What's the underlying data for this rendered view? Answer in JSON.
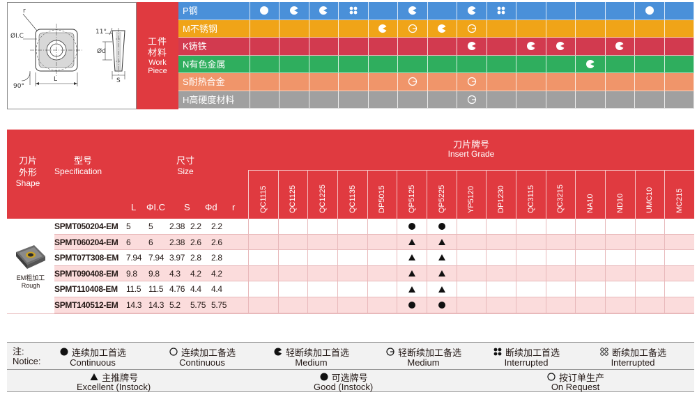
{
  "diagram": {
    "labels": {
      "r": "r",
      "ic": "ØI.C",
      "d": "Ød",
      "angle11": "11°",
      "angle90": "90°",
      "l": "L",
      "s": "S"
    }
  },
  "workpiece": {
    "label_zh_1": "工件",
    "label_zh_2": "材料",
    "label_en_1": "Work",
    "label_en_2": "Piece"
  },
  "materials": [
    {
      "name": "P钢",
      "color": "#4a90d9",
      "cells": [
        "C",
        "M",
        "M",
        "I",
        "",
        "M",
        "",
        "M",
        "I",
        "",
        "",
        "",
        "",
        "C",
        ""
      ]
    },
    {
      "name": "M不锈钢",
      "color": "#f0a418",
      "cells": [
        "",
        "",
        "",
        "",
        "M",
        "m",
        "M",
        "m",
        "",
        "",
        "",
        "",
        "",
        "",
        ""
      ]
    },
    {
      "name": "K铸铁",
      "color": "#d23a4f",
      "cells": [
        "",
        "",
        "",
        "",
        "",
        "",
        "",
        "M",
        "",
        "M",
        "M",
        "",
        "M",
        "",
        ""
      ]
    },
    {
      "name": "N有色金属",
      "color": "#2fae5e",
      "cells": [
        "",
        "",
        "",
        "",
        "",
        "",
        "",
        "",
        "",
        "",
        "",
        "M",
        "",
        "",
        ""
      ]
    },
    {
      "name": "S耐热合金",
      "color": "#f0956a",
      "cells": [
        "",
        "",
        "",
        "",
        "",
        "m",
        "",
        "m",
        "",
        "",
        "",
        "",
        "",
        "",
        ""
      ]
    },
    {
      "name": "H高硬度材料",
      "color": "#a0a0a0",
      "cells": [
        "",
        "",
        "",
        "",
        "",
        "",
        "",
        "m",
        "",
        "",
        "",
        "",
        "",
        "",
        ""
      ]
    }
  ],
  "spec": {
    "shape_zh_1": "刀片",
    "shape_zh_2": "外形",
    "shape_en": "Shape",
    "spec_zh": "型号",
    "spec_en": "Specification",
    "size_zh": "尺寸",
    "size_en": "Size",
    "grade_zh": "刀片牌号",
    "grade_en": "Insert Grade",
    "dims": [
      "L",
      "ΦI.C",
      "S",
      "Φd",
      "r"
    ],
    "grades": [
      "QC1115",
      "QC1125",
      "QC1225",
      "QC1135",
      "DP5015",
      "QP5125",
      "QP5225",
      "YP5120",
      "DP1230",
      "QC3115",
      "QC3215",
      "NA10",
      "ND10",
      "UMC10",
      "MC215"
    ],
    "shape_label_zh": "EM粗加工",
    "shape_label_en": "Rough",
    "rows": [
      {
        "model": "SPMT050204-EM",
        "L": "5",
        "IC": "5",
        "S": "2.38",
        "d": "2.2",
        "r": "2.2",
        "marks": [
          "",
          "",
          "",
          "",
          "",
          "dot",
          "dot",
          "",
          "",
          "",
          "",
          "",
          "",
          "",
          ""
        ]
      },
      {
        "model": "SPMT060204-EM",
        "L": "6",
        "IC": "6",
        "S": "2.38",
        "d": "2.6",
        "r": "2.6",
        "marks": [
          "",
          "",
          "",
          "",
          "",
          "tri",
          "tri",
          "",
          "",
          "",
          "",
          "",
          "",
          "",
          ""
        ]
      },
      {
        "model": "SPMT07T308-EM",
        "L": "7.94",
        "IC": "7.94",
        "S": "3.97",
        "d": "2.8",
        "r": "2.8",
        "marks": [
          "",
          "",
          "",
          "",
          "",
          "tri",
          "tri",
          "",
          "",
          "",
          "",
          "",
          "",
          "",
          ""
        ]
      },
      {
        "model": "SPMT090408-EM",
        "L": "9.8",
        "IC": "9.8",
        "S": "4.3",
        "d": "4.2",
        "r": "4.2",
        "marks": [
          "",
          "",
          "",
          "",
          "",
          "tri",
          "tri",
          "",
          "",
          "",
          "",
          "",
          "",
          "",
          ""
        ]
      },
      {
        "model": "SPMT110408-EM",
        "L": "11.5",
        "IC": "11.5",
        "S": "4.76",
        "d": "4.4",
        "r": "4.4",
        "marks": [
          "",
          "",
          "",
          "",
          "",
          "tri",
          "tri",
          "",
          "",
          "",
          "",
          "",
          "",
          "",
          ""
        ]
      },
      {
        "model": "SPMT140512-EM",
        "L": "14.3",
        "IC": "14.3",
        "S": "5.2",
        "d": "5.75",
        "r": "5.75",
        "marks": [
          "",
          "",
          "",
          "",
          "",
          "dot",
          "dot",
          "",
          "",
          "",
          "",
          "",
          "",
          "",
          ""
        ]
      }
    ]
  },
  "notice": {
    "label_zh": "注:",
    "label_en": "Notice:",
    "legend": [
      {
        "zh": "连续加工首选",
        "en": "Continuous",
        "icon": "filled-circle-icon"
      },
      {
        "zh": "连续加工备选",
        "en": "Continuous",
        "icon": "open-circle-icon"
      },
      {
        "zh": "轻断续加工首选",
        "en": "Medium",
        "icon": "half-filled-circle-icon"
      },
      {
        "zh": "轻断续加工备选",
        "en": "Medium",
        "icon": "half-open-circle-icon"
      },
      {
        "zh": "断续加工首选",
        "en": "Interrupted",
        "icon": "filled-cross-icon"
      },
      {
        "zh": "断续加工备选",
        "en": "Interrupted",
        "icon": "open-cross-icon"
      }
    ],
    "legend2": [
      {
        "zh": "主推牌号",
        "en": "Excellent (Instock)",
        "icon": "triangle-icon"
      },
      {
        "zh": "可选牌号",
        "en": "Good (Instock)",
        "icon": "dot-icon"
      },
      {
        "zh": "按订单生产",
        "en": "On Request",
        "icon": "circle-icon"
      }
    ]
  }
}
